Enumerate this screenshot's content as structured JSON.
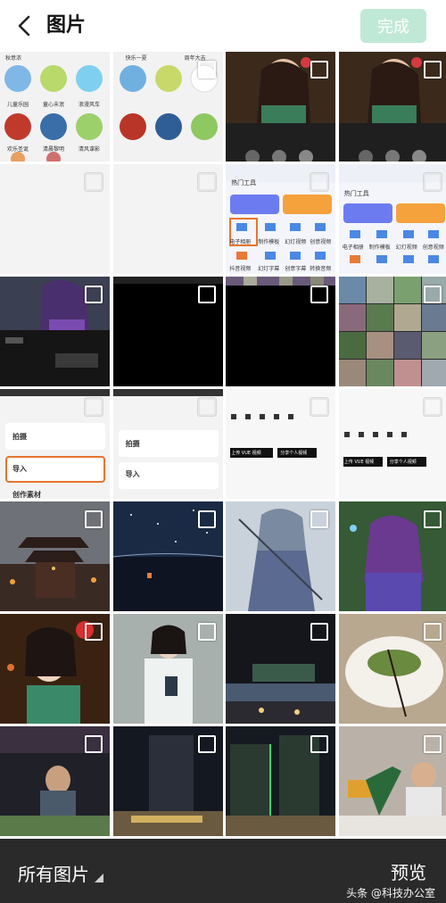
{
  "header": {
    "title": "图片",
    "done_label": "完成"
  },
  "thumb_text": {
    "app_tags_row1": [
      "秋意浓",
      "快乐一夏",
      "周年大吉"
    ],
    "app_tags_row2": [
      "儿童乐园",
      "童心未泯",
      "浪漫风车"
    ],
    "app_tags_row3": [
      "欢乐圣诞",
      "清晨黎明",
      "清风谍影"
    ],
    "tools_title": "热门工具",
    "tools_items": [
      "电子相册",
      "制作模板",
      "幻灯视频",
      "创意视频"
    ],
    "tools_items2": [
      "抖音视频",
      "幻灯字幕",
      "创意字幕",
      "转换音频"
    ],
    "import_labels": [
      "拍摄",
      "导入",
      "创作素材"
    ],
    "vue_buttons": [
      "上传 VUE 视频",
      "分享个人视频"
    ]
  },
  "footer": {
    "album_label": "所有图片",
    "preview_label": "预览",
    "watermark": "头条 @科技办公室"
  },
  "colors": {
    "done_bg": "#bfe9d6",
    "bottom_bar": "#2a2a2a"
  }
}
